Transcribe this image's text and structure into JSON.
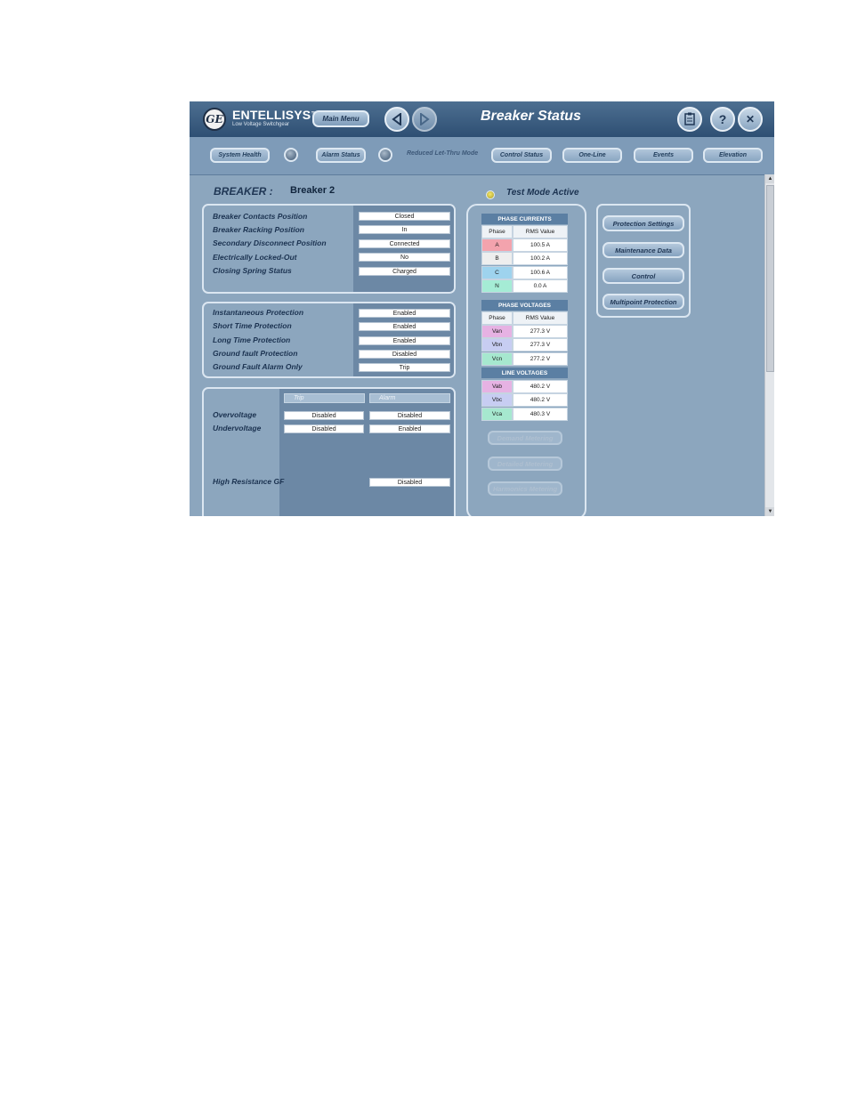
{
  "header": {
    "logo_text": "GE",
    "brand_name": "ENTELLISYS",
    "brand_tm": "™",
    "brand_subtitle": "Low Voltage Switchgear",
    "main_menu": "Main Menu",
    "back_icon": "arrow-left-icon",
    "forward_icon": "arrow-right-icon",
    "title": "Breaker Status",
    "print_icon": "printer-icon",
    "help_label": "?",
    "close_label": "✕"
  },
  "nav": {
    "system_health": "System Health",
    "alarm_status": "Alarm Status",
    "reduced_mode": "Reduced Let-Thru Mode",
    "control_status": "Control Status",
    "one_line": "One-Line",
    "events": "Events",
    "elevation": "Elevation"
  },
  "breaker": {
    "label": "BREAKER :",
    "name": "Breaker 2"
  },
  "status_panel": [
    {
      "label": "Breaker Contacts Position",
      "value": "Closed"
    },
    {
      "label": "Breaker Racking Position",
      "value": "In"
    },
    {
      "label": "Secondary Disconnect Position",
      "value": "Connected"
    },
    {
      "label": "Electrically Locked-Out",
      "value": "No"
    },
    {
      "label": "Closing Spring Status",
      "value": "Charged"
    }
  ],
  "protection_panel": [
    {
      "label": "Instantaneous Protection",
      "value": "Enabled"
    },
    {
      "label": "Short Time Protection",
      "value": "Enabled"
    },
    {
      "label": "Long Time Protection",
      "value": "Enabled"
    },
    {
      "label": "Ground fault Protection",
      "value": "Disabled"
    },
    {
      "label": "Ground Fault Alarm Only",
      "value": "Trip"
    }
  ],
  "voltage_panel": {
    "trip_header": "Trip",
    "alarm_header": "Alarm",
    "overvoltage": {
      "label": "Overvoltage",
      "trip": "Disabled",
      "alarm": "Disabled"
    },
    "undervoltage": {
      "label": "Undervoltage",
      "trip": "Disabled",
      "alarm": "Enabled"
    },
    "hrgf": {
      "label": "High Resistance GF",
      "alarm": "Disabled"
    }
  },
  "test_mode": "Test Mode Active",
  "phase_currents": {
    "title": "PHASE CURRENTS",
    "col_phase": "Phase",
    "col_value": "RMS Value",
    "rows": [
      {
        "phase": "A",
        "value": "100.5 A",
        "color": "#f3a3ad"
      },
      {
        "phase": "B",
        "value": "100.2 A",
        "color": "#eeeeee"
      },
      {
        "phase": "C",
        "value": "100.6 A",
        "color": "#9ed3ee"
      },
      {
        "phase": "N",
        "value": "0.0 A",
        "color": "#a5ecd5"
      }
    ]
  },
  "phase_voltages": {
    "title": "PHASE VOLTAGES",
    "col_phase": "Phase",
    "col_value": "RMS Value",
    "rows": [
      {
        "phase": "Van",
        "value": "277.3 V",
        "color": "#e6b2e3"
      },
      {
        "phase": "Vbn",
        "value": "277.3 V",
        "color": "#c7cdf2"
      },
      {
        "phase": "Vcn",
        "value": "277.2 V",
        "color": "#a6e8cf"
      }
    ]
  },
  "line_voltages": {
    "title": "LINE VOLTAGES",
    "rows": [
      {
        "phase": "Vab",
        "value": "480.2 V",
        "color": "#e6b2e3"
      },
      {
        "phase": "Vbc",
        "value": "480.2 V",
        "color": "#c7cdf2"
      },
      {
        "phase": "Vca",
        "value": "480.3 V",
        "color": "#a6e8cf"
      }
    ]
  },
  "metering_buttons": {
    "demand": "Demand Metering",
    "detailed": "Detailed Metering",
    "harmonics": "Harmonics Metering"
  },
  "side_buttons": {
    "protection": "Protection Settings",
    "maintenance": "Maintenance Data",
    "control": "Control",
    "multipoint": "Multipoint Protection"
  }
}
